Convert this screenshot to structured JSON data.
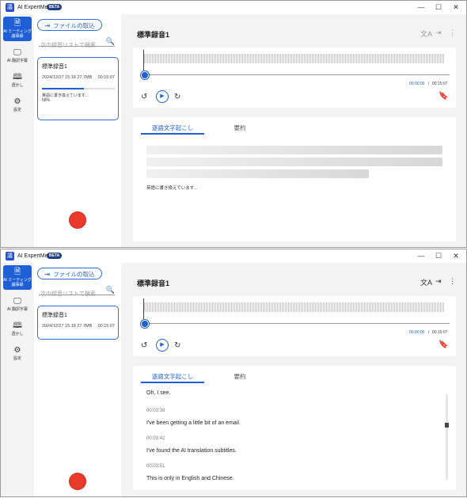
{
  "app": {
    "name": "AI ExpertMeet",
    "beta": "BETA",
    "logo": "議"
  },
  "window_controls": {
    "minimize": "—",
    "maximize": "☐",
    "close": "✕"
  },
  "rail": {
    "meeting": {
      "icon": "🗎",
      "label": "AI ミーティング議事録"
    },
    "translation": {
      "icon": "🖵",
      "label": "AI 翻訳字幕"
    },
    "script": {
      "icon": "🕮",
      "label": "透かし"
    },
    "settings": {
      "icon": "⚙",
      "label": "設定"
    }
  },
  "list": {
    "import_icon": "⇥",
    "import_label": "ファイルの取込",
    "search_placeholder": "次の録音リストで検索...",
    "search_icon": "🔍",
    "item": {
      "title": "標準録音1",
      "meta": "2024/12/27 15:18 27.7MB",
      "duration": "00:15:07",
      "progress": 0.58,
      "status": "英語に書き換えています...",
      "percent": "58%"
    }
  },
  "main": {
    "title": "標準録音1",
    "icons": {
      "translate": "文A",
      "share": "⇥",
      "more": "⋮"
    },
    "player": {
      "time_current": "00:00:00",
      "time_sep": "/",
      "time_total": "00:15:07",
      "back_icon": "↺",
      "play_icon": "▶",
      "forward_icon": "↻",
      "bookmark_icon": "🔖"
    },
    "tabs": {
      "transcript": "逐語文字起こし",
      "summary": "要約"
    },
    "processing_text": "英語に書き換えています...",
    "transcript": [
      {
        "time": "",
        "text": "Oh, I see."
      },
      {
        "time": "00:03:39",
        "text": "I've been getting a little bit of an email."
      },
      {
        "time": "00:03:42",
        "text": "I've found the AI translation subtitles."
      },
      {
        "time": "00:03:51",
        "text": "This is only in English and Chinese."
      }
    ]
  }
}
